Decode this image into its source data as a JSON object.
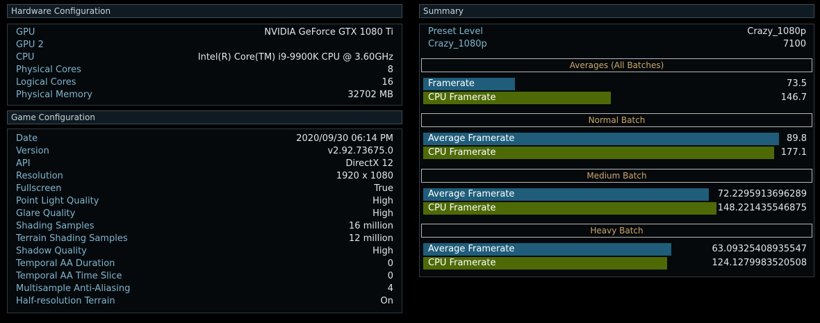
{
  "hardware": {
    "title": "Hardware Configuration",
    "rows": [
      {
        "label": "GPU",
        "value": "NVIDIA GeForce GTX 1080 Ti"
      },
      {
        "label": "GPU 2",
        "value": ""
      },
      {
        "label": "CPU",
        "value": "Intel(R) Core(TM) i9-9900K CPU @ 3.60GHz"
      },
      {
        "label": "Physical Cores",
        "value": "8"
      },
      {
        "label": "Logical Cores",
        "value": "16"
      },
      {
        "label": "Physical Memory",
        "value": "32702 MB"
      }
    ]
  },
  "game": {
    "title": "Game Configuration",
    "rows": [
      {
        "label": "Date",
        "value": "2020/09/30 06:14 PM"
      },
      {
        "label": "Version",
        "value": "v2.92.73675.0"
      },
      {
        "label": "API",
        "value": "DirectX 12"
      },
      {
        "label": "Resolution",
        "value": "1920 x 1080"
      },
      {
        "label": "Fullscreen",
        "value": "True"
      },
      {
        "label": "Point Light Quality",
        "value": "High"
      },
      {
        "label": "Glare Quality",
        "value": "High"
      },
      {
        "label": "Shading Samples",
        "value": "16 million"
      },
      {
        "label": "Terrain Shading Samples",
        "value": "12 million"
      },
      {
        "label": "Shadow Quality",
        "value": "High"
      },
      {
        "label": "Temporal AA Duration",
        "value": "0"
      },
      {
        "label": "Temporal AA Time Slice",
        "value": "0"
      },
      {
        "label": "Multisample Anti-Aliasing",
        "value": "4"
      },
      {
        "label": "Half-resolution Terrain",
        "value": "On"
      }
    ]
  },
  "summary": {
    "title": "Summary",
    "rows": [
      {
        "label": "Preset Level",
        "value": "Crazy_1080p"
      },
      {
        "label": "Crazy_1080p",
        "value": "7100"
      }
    ],
    "sections": [
      {
        "title": "Averages (All Batches)",
        "bars": [
          {
            "label": "Framerate",
            "value": "73.5",
            "fill": 0.24
          },
          {
            "label": "CPU Framerate",
            "value": "146.7",
            "fill": 0.49
          }
        ]
      },
      {
        "title": "Normal Batch",
        "bars": [
          {
            "label": "Average Framerate",
            "value": "89.8",
            "fill": 0.927
          },
          {
            "label": "CPU Framerate",
            "value": "177.1",
            "fill": 0.915
          }
        ]
      },
      {
        "title": "Medium Batch",
        "bars": [
          {
            "label": "Average Framerate",
            "value": "72.2295913696289",
            "fill": 0.745
          },
          {
            "label": "CPU Framerate",
            "value": "148.221435546875",
            "fill": 0.765
          }
        ]
      },
      {
        "title": "Heavy Batch",
        "bars": [
          {
            "label": "Average Framerate",
            "value": "63.09325408935547",
            "fill": 0.647
          },
          {
            "label": "CPU Framerate",
            "value": "124.1279983520508",
            "fill": 0.635
          }
        ]
      }
    ]
  },
  "colors": {
    "framerate_bar": "#1f5d7a",
    "cpu_bar": "#4e6a07",
    "section_title": "#c9a86a",
    "label": "#7fb5cf"
  }
}
